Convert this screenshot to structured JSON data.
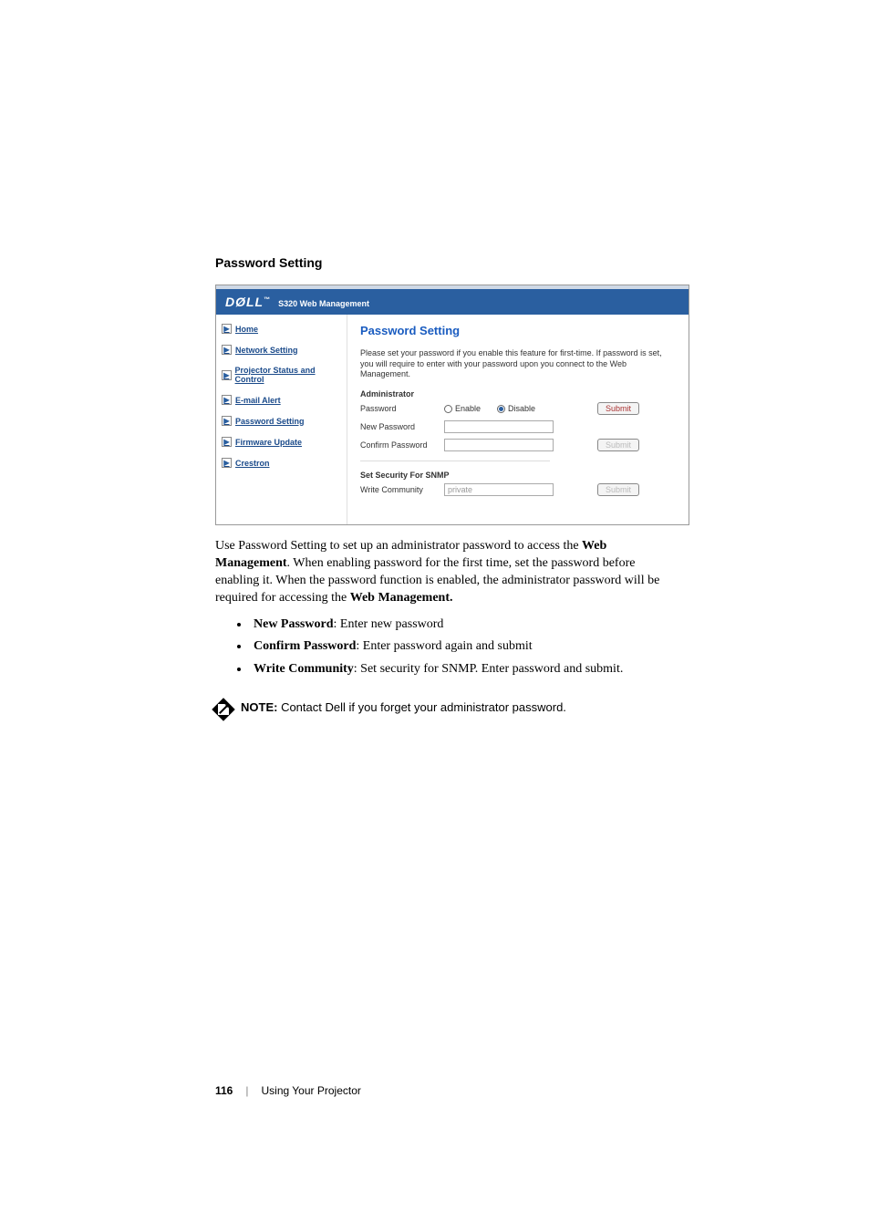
{
  "heading": "Password Setting",
  "screenshot": {
    "brand": "DØLL",
    "brand_tm": "™",
    "subtitle": "S320 Web Management",
    "nav": [
      "Home",
      "Network Setting",
      "Projector Status and Control",
      "E-mail Alert",
      "Password Setting",
      "Firmware Update",
      "Crestron"
    ],
    "title": "Password Setting",
    "desc": "Please set your password if you enable this feature for first-time. If password is set, you will require to enter with your password upon you connect to the Web Management.",
    "admin_label": "Administrator",
    "rows": {
      "password": "Password",
      "enable": "Enable",
      "disable": "Disable",
      "new_password": "New Password",
      "confirm_password": "Confirm Password"
    },
    "snmp_label": "Set Security For SNMP",
    "write_community": "Write Community",
    "write_value": "private",
    "submit": "Submit"
  },
  "body": {
    "para": "Use Password Setting to set up an administrator password to access the ",
    "para_b1": "Web Management",
    "para2": ". When enabling password for the first time, set the password before enabling it. When the password function is enabled, the administrator password will be required for accessing the ",
    "para_b2": "Web Management.",
    "bullets": [
      {
        "b": "New Password",
        "t": ": Enter new password"
      },
      {
        "b": "Confirm Password",
        "t": ": Enter password again and submit"
      },
      {
        "b": "Write Community",
        "t": ": Set security for SNMP. Enter password and submit."
      }
    ]
  },
  "note": {
    "label": "NOTE:",
    "text": " Contact Dell if you forget your administrator password."
  },
  "footer": {
    "page": "116",
    "section": "Using Your Projector"
  }
}
